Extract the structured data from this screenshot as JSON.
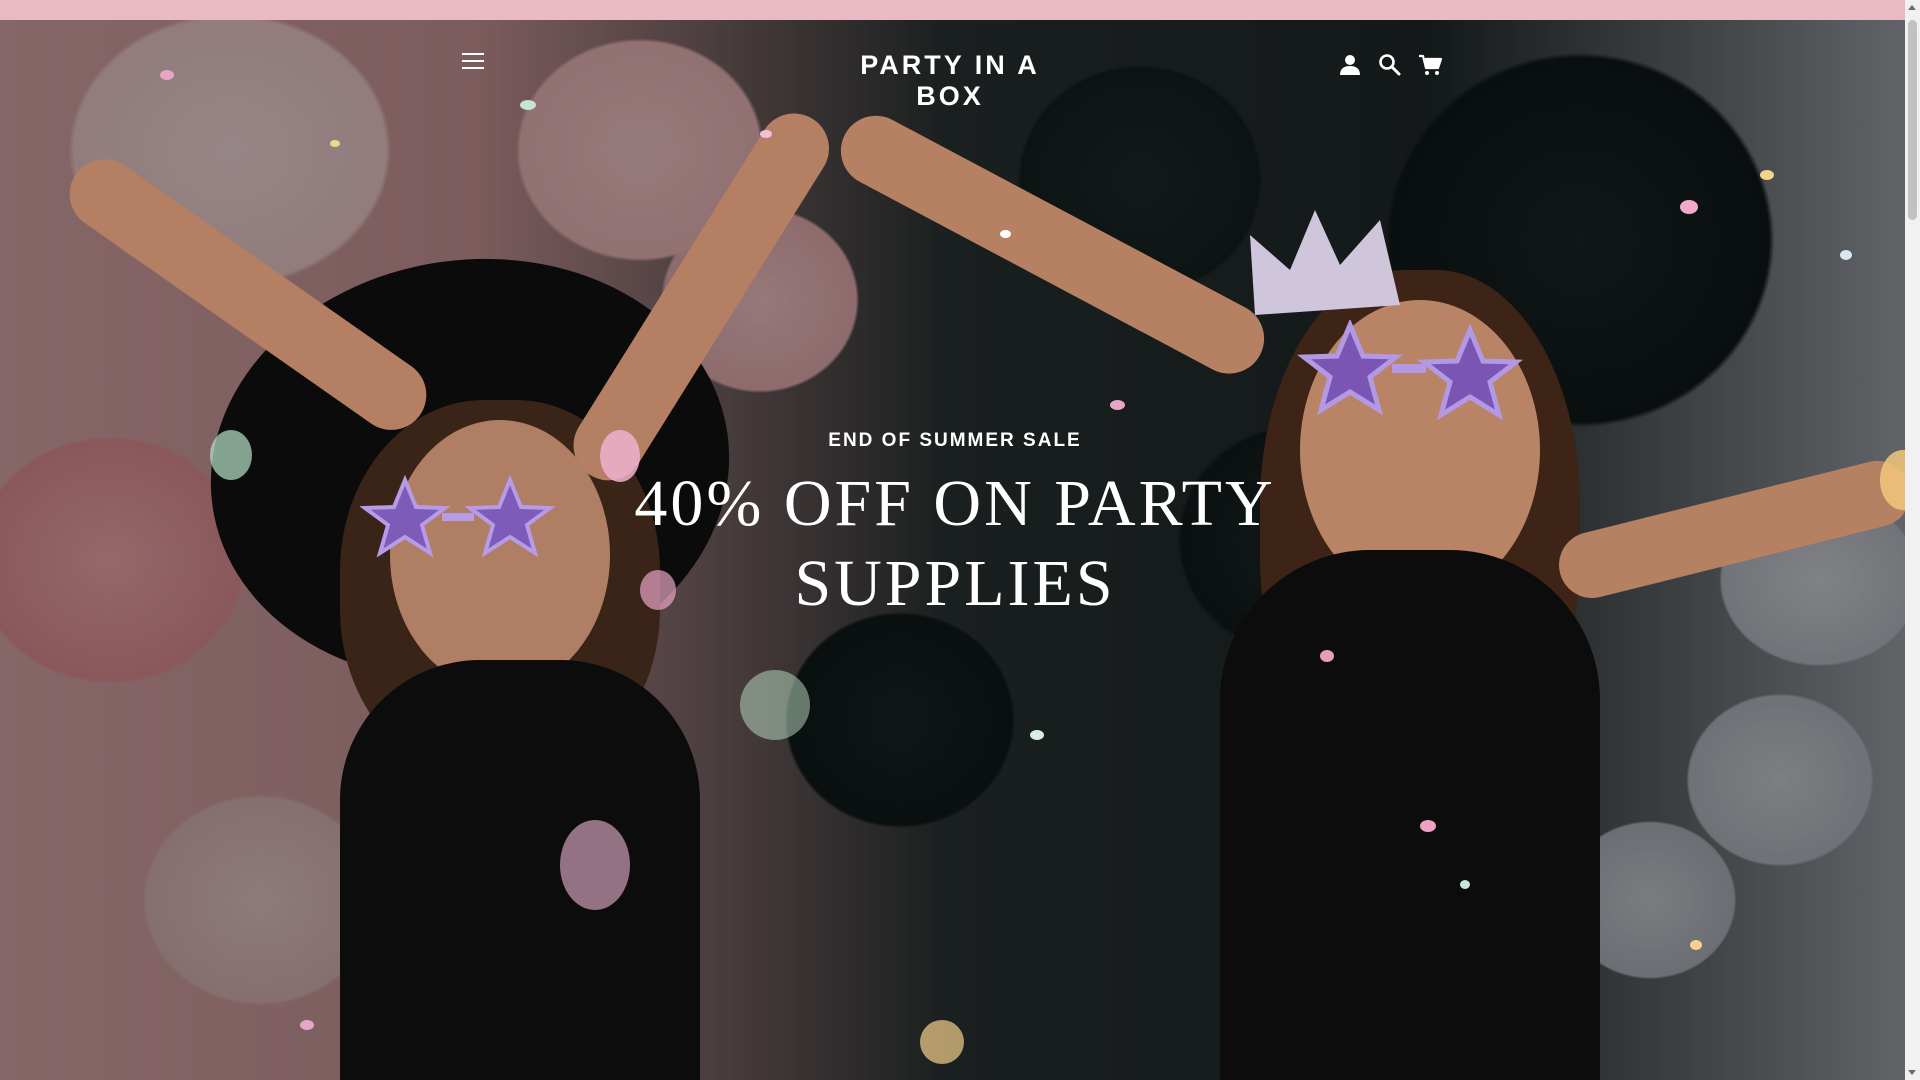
{
  "brand": {
    "name": "PARTY IN A BOX",
    "accent": "#e9b9c4"
  },
  "header": {
    "menu_icon": "hamburger-menu-icon",
    "account_icon": "user-icon",
    "search_icon": "search-icon",
    "cart_icon": "cart-icon"
  },
  "hero": {
    "eyebrow": "END OF SUMMER SALE",
    "headline_line1": "40% OFF ON PARTY",
    "headline_line2": "SUPPLIES"
  }
}
